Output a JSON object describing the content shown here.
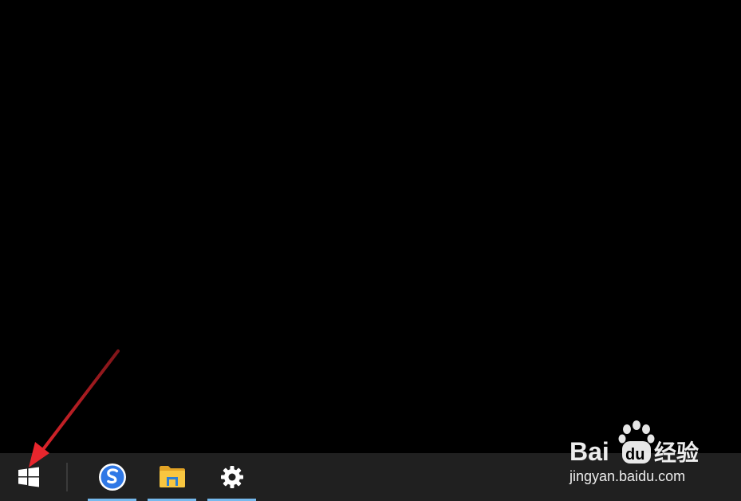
{
  "desktop": {
    "background_color": "#000000"
  },
  "taskbar": {
    "background_color": "#202020",
    "start_button": {
      "icon": "windows-logo-icon",
      "color": "#ffffff"
    },
    "pinned_apps": [
      {
        "icon": "sogou-browser-icon",
        "running": true
      },
      {
        "icon": "file-explorer-icon",
        "running": true
      },
      {
        "icon": "settings-gear-icon",
        "running": true
      }
    ],
    "running_indicator_color": "#76b9ed"
  },
  "annotation": {
    "arrow_color": "#e8262d",
    "points_to": "start-button"
  },
  "watermark": {
    "brand": "Bai",
    "brand_suffix": "du",
    "product": "经验",
    "url": "jingyan.baidu.com"
  }
}
